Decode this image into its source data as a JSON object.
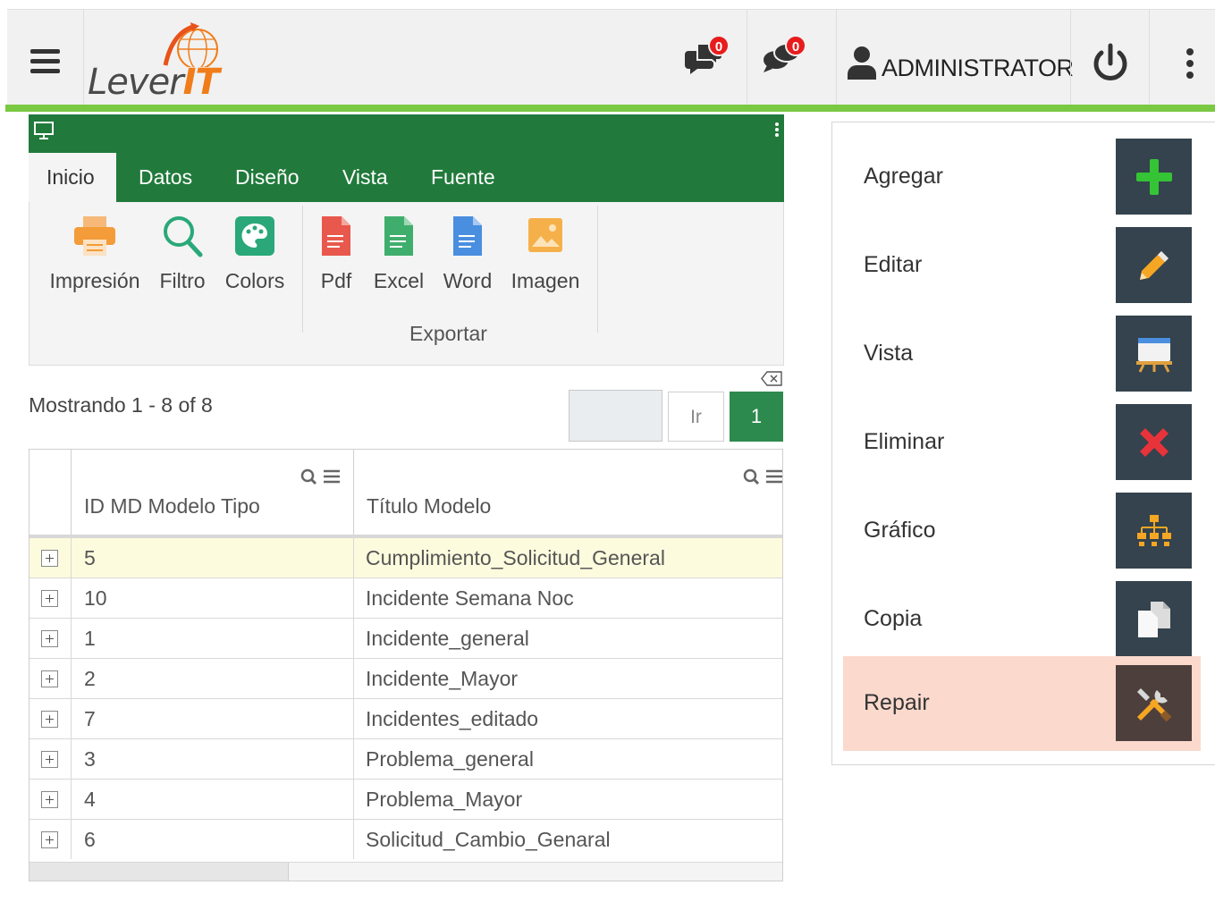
{
  "header": {
    "logo_text_1": "Lever",
    "logo_text_2": "IT",
    "messages_badge": "0",
    "chats_badge": "0",
    "user_name": "ADMINISTRATOR"
  },
  "ribbon": {
    "tabs": [
      {
        "label": "Inicio"
      },
      {
        "label": "Datos"
      },
      {
        "label": "Diseño"
      },
      {
        "label": "Vista"
      },
      {
        "label": "Fuente"
      }
    ],
    "buttons": {
      "print": "Impresión",
      "filter": "Filtro",
      "colors": "Colors",
      "pdf": "Pdf",
      "excel": "Excel",
      "word": "Word",
      "image": "Imagen"
    },
    "export_group": "Exportar"
  },
  "pager": {
    "showing": "Mostrando 1 - 8 of 8",
    "go_label": "Ir",
    "page": "1"
  },
  "grid": {
    "columns": [
      "ID MD Modelo Tipo",
      "Título Modelo"
    ],
    "rows": [
      {
        "id": "5",
        "title": "Cumplimiento_Solicitud_General"
      },
      {
        "id": "10",
        "title": "Incidente Semana Noc"
      },
      {
        "id": "1",
        "title": "Incidente_general"
      },
      {
        "id": "2",
        "title": "Incidente_Mayor"
      },
      {
        "id": "7",
        "title": "Incidentes_editado"
      },
      {
        "id": "3",
        "title": "Problema_general"
      },
      {
        "id": "4",
        "title": "Problema_Mayor"
      },
      {
        "id": "6",
        "title": "Solicitud_Cambio_Genaral"
      }
    ]
  },
  "actions": [
    {
      "label": "Agregar",
      "icon": "plus-icon"
    },
    {
      "label": "Editar",
      "icon": "pencil-icon"
    },
    {
      "label": "Vista",
      "icon": "easel-icon"
    },
    {
      "label": "Eliminar",
      "icon": "x-icon"
    },
    {
      "label": "Gráfico",
      "icon": "org-chart-icon"
    },
    {
      "label": "Copia",
      "icon": "copy-icon"
    },
    {
      "label": "Repair",
      "icon": "tools-icon"
    }
  ],
  "colors": {
    "ribbon_green": "#217a3b",
    "accent_line": "#7ac943",
    "page_button": "#2d8a4e",
    "action_tile": "#34434d",
    "highlight_row": "#fbd9cd",
    "badge_red": "#e81c1c"
  }
}
